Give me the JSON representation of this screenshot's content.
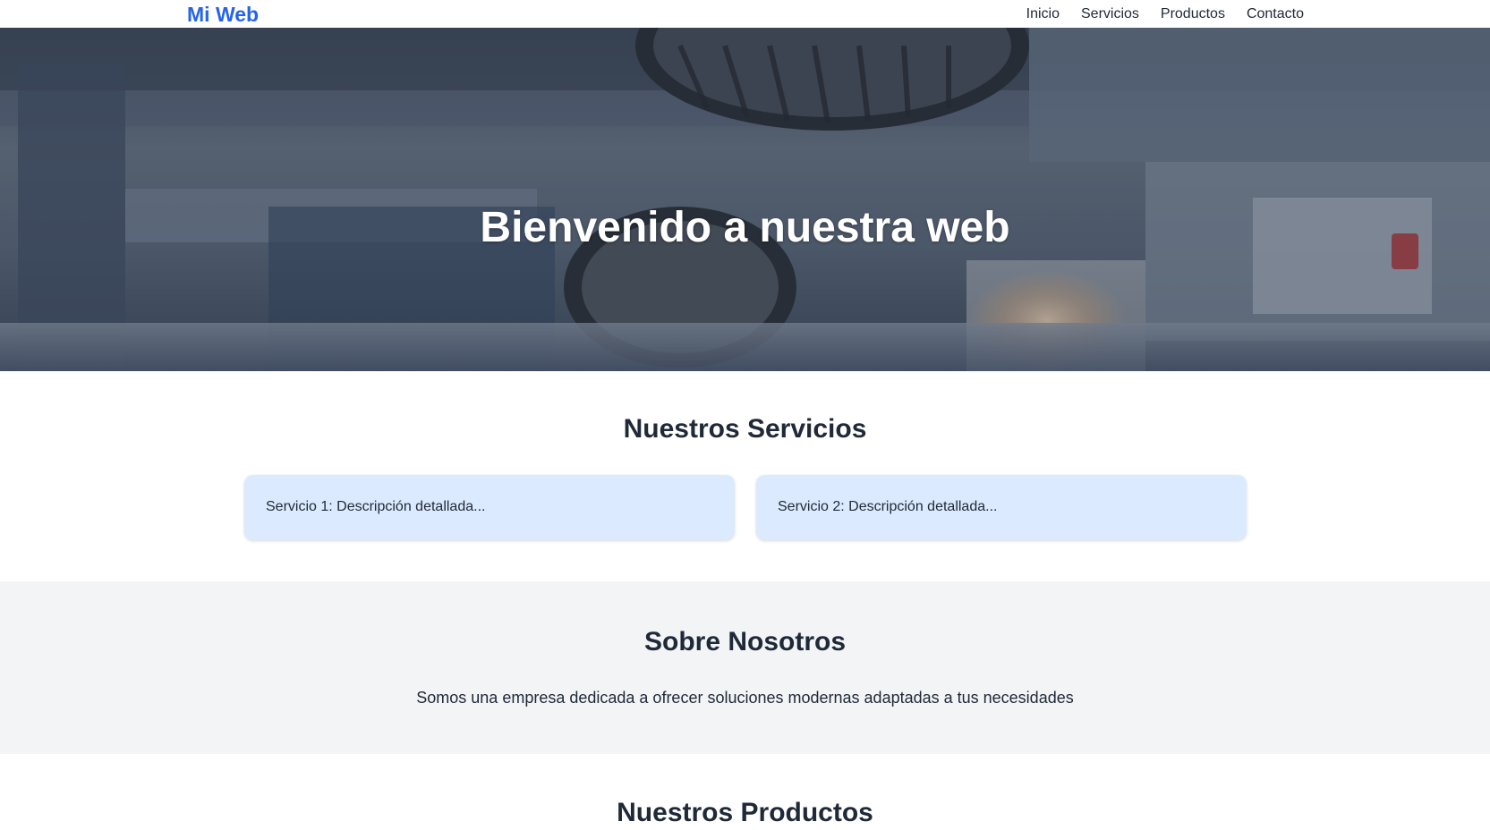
{
  "nav": {
    "brand": "Mi Web",
    "links": [
      "Inicio",
      "Servicios",
      "Productos",
      "Contacto"
    ]
  },
  "hero": {
    "title": "Bienvenido a nuestra web",
    "background_description_icon": "garage-car-lift-photo"
  },
  "services": {
    "title": "Nuestros Servicios",
    "items": [
      "Servicio 1: Descripción detallada...",
      "Servicio 2: Descripción detallada..."
    ]
  },
  "about": {
    "title": "Sobre Nosotros",
    "text": "Somos una empresa dedicada a ofrecer soluciones modernas adaptadas a tus necesidades"
  },
  "products": {
    "title": "Nuestros Productos"
  },
  "colors": {
    "brand": "#2563eb",
    "card_bg": "#dbeafe",
    "about_bg": "#f3f4f6",
    "text": "#1f2937"
  }
}
